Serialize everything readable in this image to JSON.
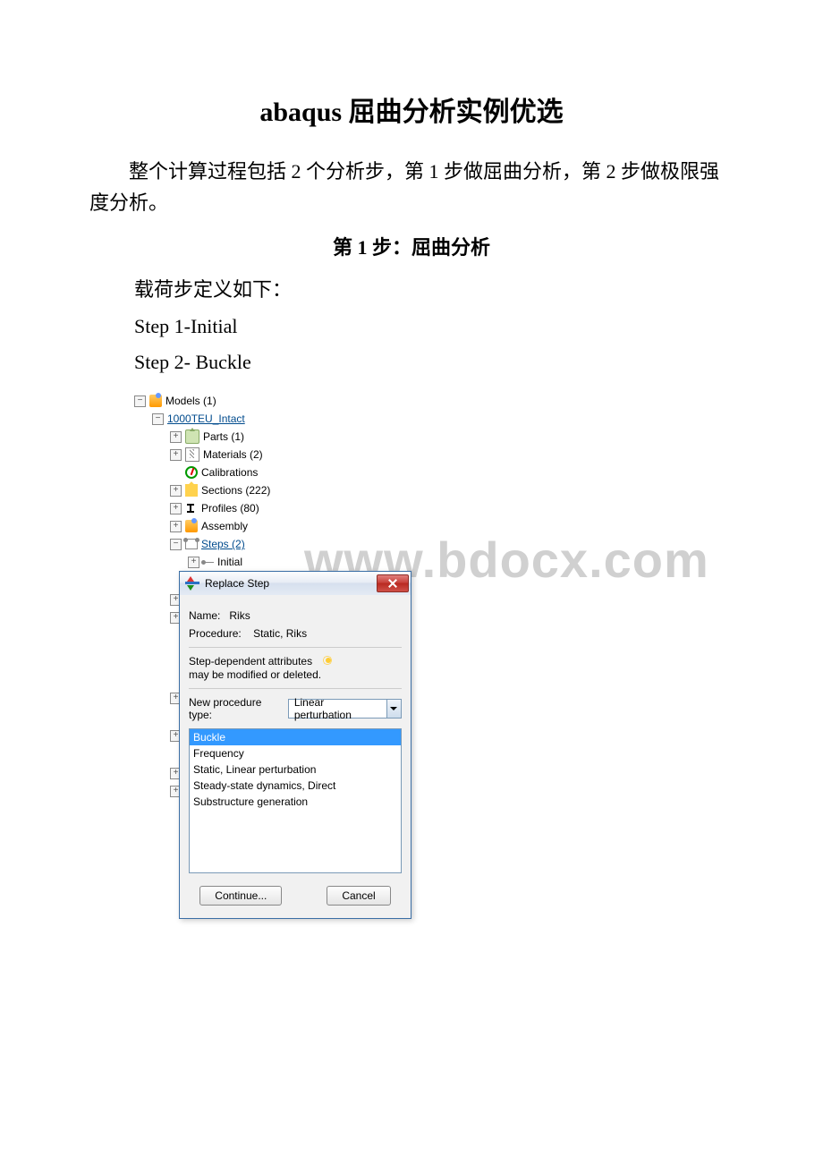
{
  "doc": {
    "title": "abaqus 屈曲分析实例优选",
    "intro": "整个计算过程包括 2 个分析步，第 1 步做屈曲分析，第 2 步做极限强度分析。",
    "section": "第 1 步：屈曲分析",
    "p1": "载荷步定义如下：",
    "p2": "Step 1-Initial",
    "p3": "Step 2- Buckle"
  },
  "watermark": "www.bdocx.com",
  "tree": {
    "models": "Models (1)",
    "model_name": "1000TEU_Intact",
    "parts": "Parts (1)",
    "materials": "Materials (2)",
    "calibrations": "Calibrations",
    "sections": "Sections (222)",
    "profiles": "Profiles (80)",
    "assembly": "Assembly",
    "steps": "Steps (2)",
    "initial": "Initial"
  },
  "dialog": {
    "title": "Replace Step",
    "name_label": "Name:",
    "name_value": "Riks",
    "proc_label": "Procedure:",
    "proc_value": "Static, Riks",
    "hint1": "Step-dependent attributes",
    "hint2": "may be modified or deleted.",
    "combo_label": "New procedure type:",
    "combo_value": "Linear perturbation",
    "list": {
      "i0": "Buckle",
      "i1": "Frequency",
      "i2": "Static, Linear perturbation",
      "i3": "Steady-state dynamics, Direct",
      "i4": "Substructure generation"
    },
    "continue": "Continue...",
    "cancel": "Cancel"
  }
}
